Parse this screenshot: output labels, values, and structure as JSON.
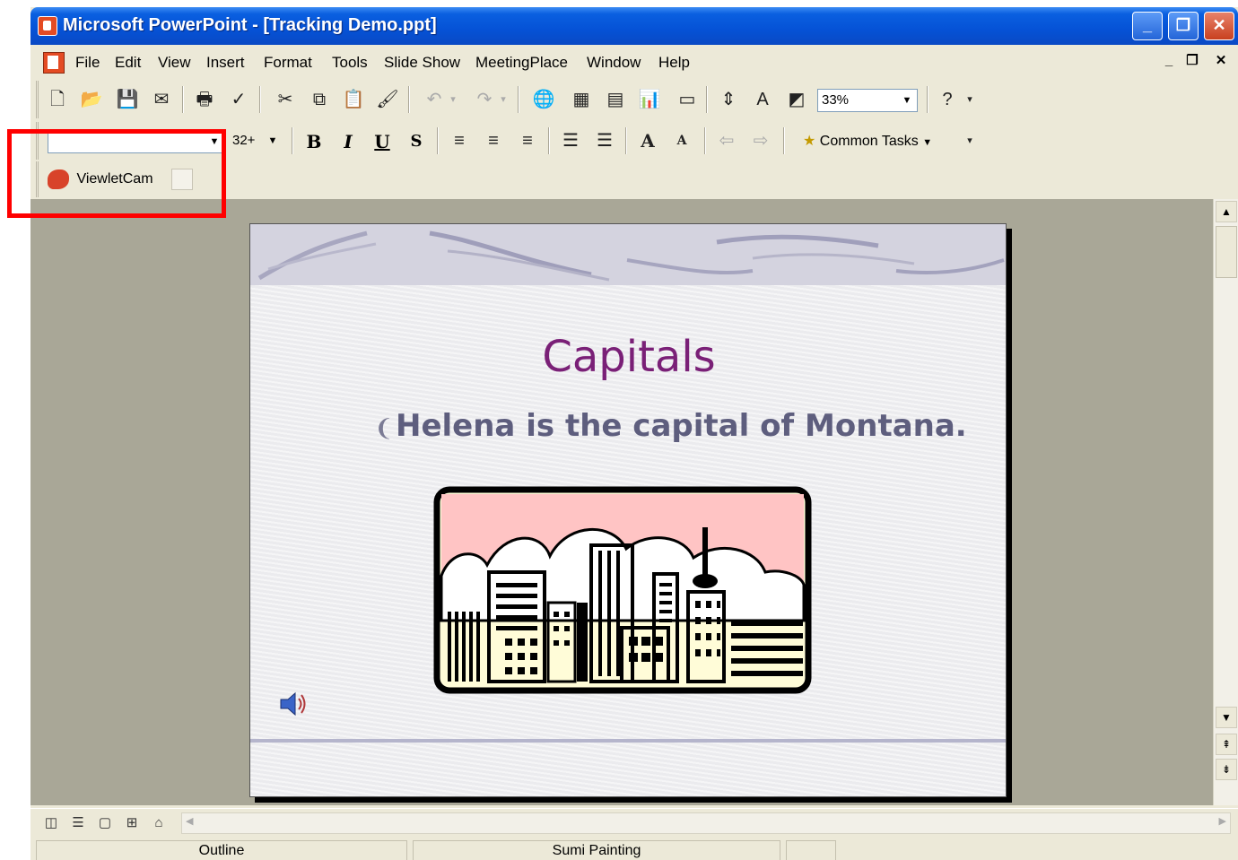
{
  "window": {
    "title": "Microsoft PowerPoint - [Tracking Demo.ppt]",
    "min_glyph": "_",
    "restore_glyph": "❐",
    "close_glyph": "✕"
  },
  "menubar": {
    "items": [
      "File",
      "Edit",
      "View",
      "Insert",
      "Format",
      "Tools",
      "Slide Show",
      "MeetingPlace",
      "Window",
      "Help"
    ],
    "mdi": [
      "_",
      "❐",
      "✕"
    ]
  },
  "standard_toolbar": {
    "zoom": "33%"
  },
  "format_toolbar": {
    "font_name": "",
    "font_size": "32+",
    "bold": "B",
    "italic": "I",
    "underline": "U",
    "shadow": "S",
    "common_tasks": "Common Tasks"
  },
  "viewlet_toolbar": {
    "label": "ViewletCam"
  },
  "slide": {
    "title": "Capitals",
    "bullet": "Helena is the capital of Montana."
  },
  "statusbar": {
    "panel1": "Outline",
    "panel2": "Sumi Painting"
  },
  "colors": {
    "title_text": "#7a2077",
    "bullet_text": "#5e5e7e",
    "highlight": "#ff0000",
    "work_area": "#a9a797"
  }
}
